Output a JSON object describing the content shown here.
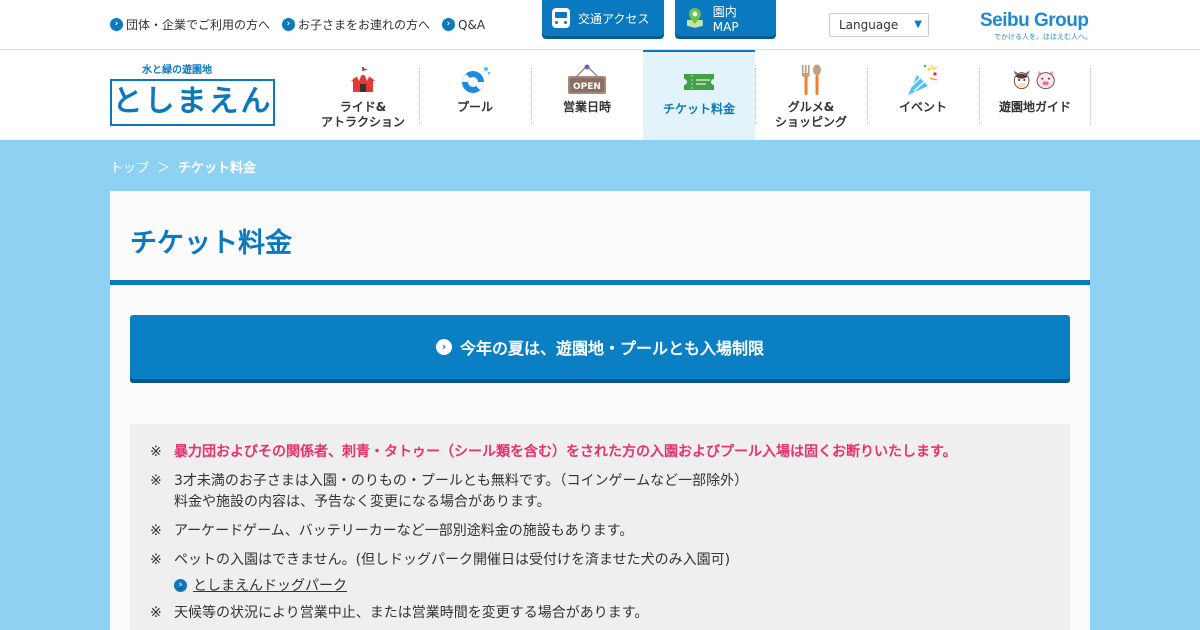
{
  "topbar": {
    "links": [
      {
        "label": "団体・企業でご利用の方へ"
      },
      {
        "label": "お子さまをお連れの方へ"
      },
      {
        "label": "Q&A"
      }
    ],
    "access_button": "交通アクセス",
    "map_button": "園内MAP",
    "language": "Language",
    "brand": {
      "name": "Seibu Group",
      "tagline": "でかける人を、ほほえむ人へ。"
    }
  },
  "logo": {
    "tagline": "水と緑の遊園地",
    "name": "としまえん"
  },
  "nav": {
    "items": [
      {
        "label": "ライド&\nアトラクション",
        "icon": "circus-tent-icon"
      },
      {
        "label": "プール",
        "icon": "swim-ring-icon"
      },
      {
        "label": "営業日時",
        "icon": "open-sign-icon",
        "icon_text": "OPEN"
      },
      {
        "label": "チケット料金",
        "icon": "ticket-icon",
        "active": true
      },
      {
        "label": "グルメ&\nショッピング",
        "icon": "fork-spoon-icon"
      },
      {
        "label": "イベント",
        "icon": "party-popper-icon"
      },
      {
        "label": "遊園地ガイド",
        "icon": "mascot-icon"
      }
    ]
  },
  "breadcrumb": {
    "home": "トップ",
    "separator": "＞",
    "current": "チケット料金"
  },
  "page": {
    "title": "チケット料金",
    "notice_button": "今年の夏は、遊園地・プールとも入場制限",
    "notes": [
      {
        "mark": "※",
        "text": "暴力団およびその関係者、刺青・タトゥー（シール類を含む）をされた方の入園およびプール入場は固くお断りいたします。",
        "warning": true
      },
      {
        "mark": "※",
        "text": "3才未満のお子さまは入園・のりもの・プールとも無料です。（コインゲームなど一部除外）\n料金や施設の内容は、予告なく変更になる場合があります。"
      },
      {
        "mark": "※",
        "text": "アーケードゲーム、バッテリーカーなど一部別途料金の施設もあります。"
      },
      {
        "mark": "※",
        "text": "ペットの入園はできません。(但しドッグパーク開催日は受付けを済ませた犬のみ入園可)"
      },
      {
        "mark": "※",
        "text": "天候等の状況により営業中止、または営業時間を変更する場合があります。"
      }
    ],
    "dogpark_link": "としまえんドッグパーク"
  },
  "colors": {
    "brand_blue": "#0a79bf",
    "sky": "#8fd1f2",
    "warning": "#e8316d"
  }
}
